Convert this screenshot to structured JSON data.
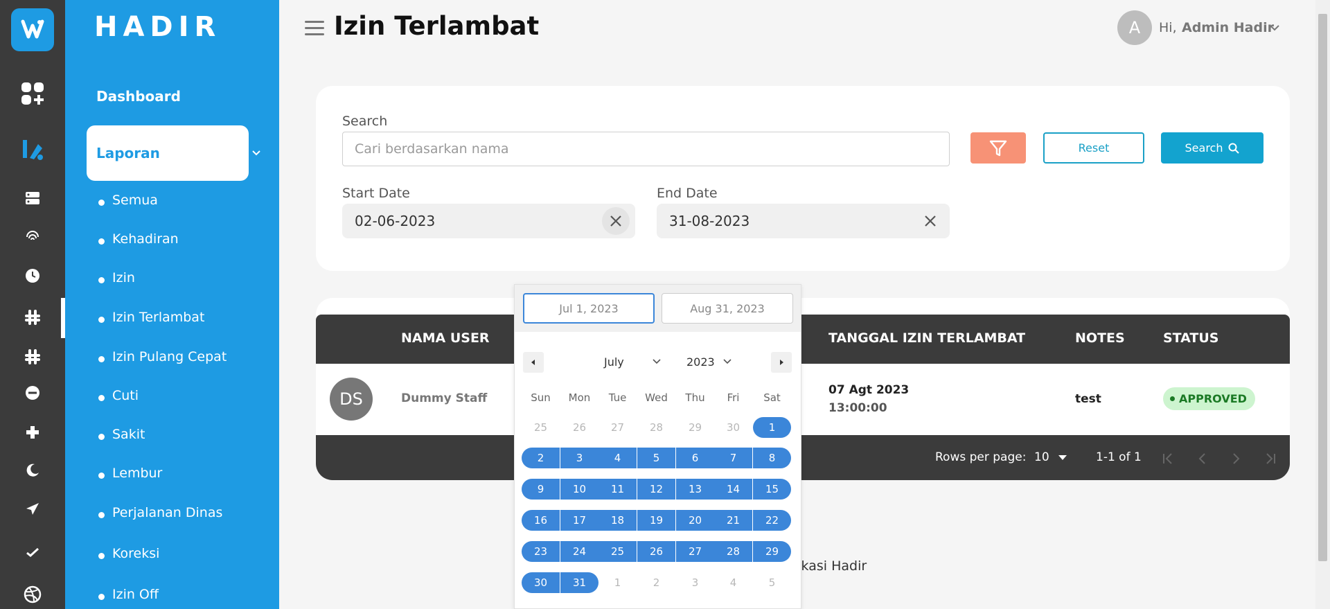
{
  "app": {
    "brand": "HADIR"
  },
  "sidebar": {
    "dashboard": "Dashboard",
    "laporan": "Laporan",
    "items": [
      {
        "label": "Semua"
      },
      {
        "label": "Kehadiran"
      },
      {
        "label": "Izin"
      },
      {
        "label": "Izin Terlambat"
      },
      {
        "label": "Izin Pulang Cepat"
      },
      {
        "label": "Cuti"
      },
      {
        "label": "Sakit"
      },
      {
        "label": "Lembur"
      },
      {
        "label": "Perjalanan Dinas"
      },
      {
        "label": "Koreksi"
      },
      {
        "label": "Izin Off"
      }
    ]
  },
  "rail_icons": [
    "logo-icon",
    "dashboard-add-icon",
    "report-icon",
    "server-icon",
    "fingerprint-icon",
    "clock-icon",
    "slack-icon",
    "slack-icon-2",
    "minus-circle-icon",
    "plus-icon",
    "moon-icon",
    "airplane-icon",
    "check-icon",
    "dribbble-icon"
  ],
  "header": {
    "title": "Izin Terlambat",
    "avatar_letter": "A",
    "greeting": "Hi,",
    "user_name": "Admin Hadir"
  },
  "filter": {
    "search_label": "Search",
    "search_placeholder": "Cari berdasarkan nama",
    "reset_label": "Reset",
    "search_button": "Search",
    "start_label": "Start Date",
    "start_value": "02-06-2023",
    "end_label": "End Date",
    "end_value": "31-08-2023"
  },
  "table": {
    "headers": {
      "nama": "NAMA USER",
      "tanggal": "TANGGAL IZIN TERLAMBAT",
      "notes": "NOTES",
      "status": "STATUS"
    },
    "rows": [
      {
        "initials": "DS",
        "name": "Dummy Staff",
        "date": "07 Agt 2023",
        "time": "13:00:00",
        "notes": "test",
        "status": "APPROVED"
      }
    ],
    "rows_per_page_label": "Rows per page:",
    "rows_per_page": "10",
    "range": "1-1 of 1"
  },
  "footer": {
    "text": "likasi Hadir"
  },
  "datepicker": {
    "start_input": "Jul 1, 2023",
    "end_input": "Aug 31, 2023",
    "month": "July",
    "year": "2023",
    "weekdays": [
      "Sun",
      "Mon",
      "Tue",
      "Wed",
      "Thu",
      "Fri",
      "Sat"
    ],
    "weeks": [
      [
        "25",
        "26",
        "27",
        "28",
        "29",
        "30",
        "1"
      ],
      [
        "2",
        "3",
        "4",
        "5",
        "6",
        "7",
        "8"
      ],
      [
        "9",
        "10",
        "11",
        "12",
        "13",
        "14",
        "15"
      ],
      [
        "16",
        "17",
        "18",
        "19",
        "20",
        "21",
        "22"
      ],
      [
        "23",
        "24",
        "25",
        "26",
        "27",
        "28",
        "29"
      ],
      [
        "30",
        "31",
        "1",
        "2",
        "3",
        "4",
        "5"
      ]
    ]
  },
  "colors": {
    "sidebar": "#1e9be3",
    "rail": "#3b3b3b",
    "accent": "#13a3cf",
    "filter_btn": "#f79276",
    "range": "#3b86d9"
  }
}
